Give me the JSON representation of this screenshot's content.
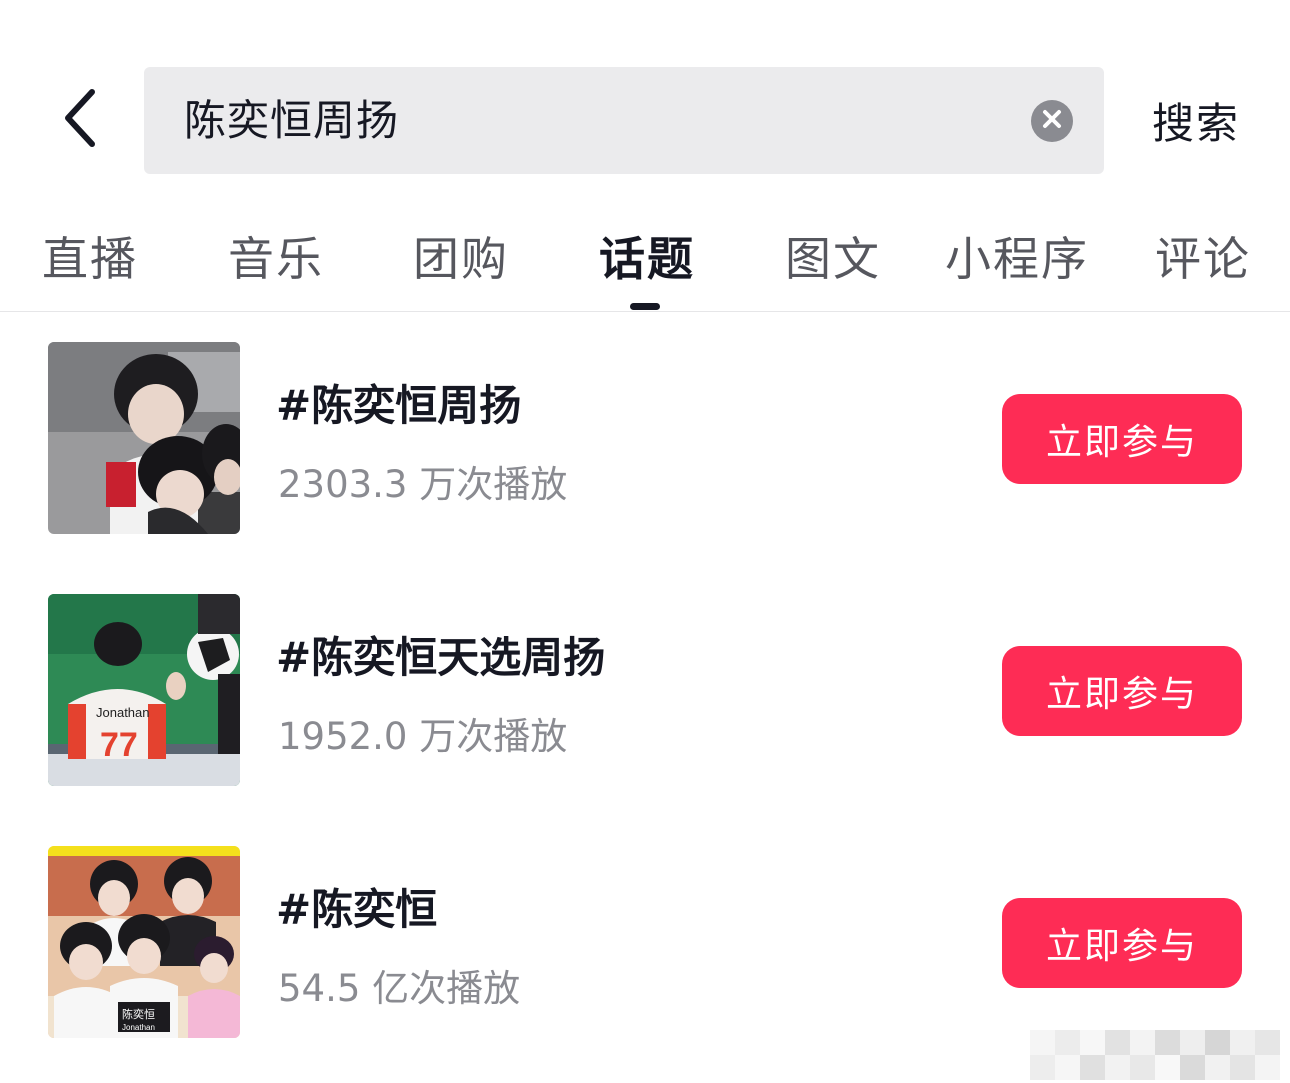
{
  "header": {
    "back_icon": "chevron-left-icon",
    "query": "陈奕恒周扬",
    "clear_icon": "clear-circle-icon",
    "search_label": "搜索"
  },
  "tabs": [
    {
      "label": "直播"
    },
    {
      "label": "音乐"
    },
    {
      "label": "团购"
    },
    {
      "label": "话题",
      "active": true
    },
    {
      "label": "图文"
    },
    {
      "label": "小程序"
    },
    {
      "label": "评论"
    }
  ],
  "topics": [
    {
      "title": "#陈奕恒周扬",
      "plays": "2303.3 万次播放",
      "button": "立即参与"
    },
    {
      "title": "#陈奕恒天选周扬",
      "plays": "1952.0 万次播放",
      "button": "立即参与"
    },
    {
      "title": "#陈奕恒",
      "plays": "54.5 亿次播放",
      "button": "立即参与"
    }
  ],
  "thumb_texts": {
    "jersey": "Jonathan",
    "jersey_number": "77",
    "shirt_name": "陈奕恒",
    "shirt_sub": "Jonathan"
  },
  "colors": {
    "accent": "#fe2c55",
    "text_primary": "#161823",
    "text_secondary": "#8a8b91",
    "search_bg": "#ebebed"
  }
}
